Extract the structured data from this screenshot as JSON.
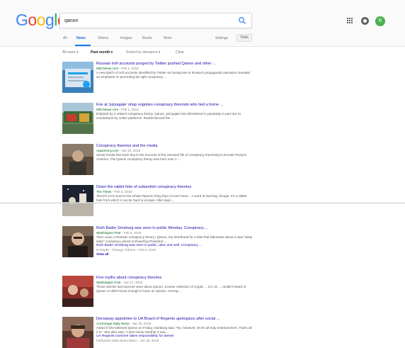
{
  "header": {
    "logo": [
      "G",
      "o",
      "o",
      "g",
      "l",
      "e"
    ],
    "logo_colors": [
      "#4285f4",
      "#ea4335",
      "#fbbc05",
      "#4285f4",
      "#34a853",
      "#ea4335"
    ],
    "search_value": "qanon",
    "avatar_letter": "R",
    "avatar_color": "#4caf50"
  },
  "tabs": {
    "items": [
      "All",
      "News",
      "Videos",
      "Images",
      "Books",
      "More"
    ],
    "active": "News",
    "settings_label": "Settings",
    "tools_label": "Tools"
  },
  "filters": {
    "news_type": "All news ▾",
    "time": "Past month ▾",
    "sort": "Sorted by relevance ▾",
    "clear": "Clear"
  },
  "results": [
    {
      "title": "Russian troll accounts purged by Twitter pushed Qanon and other ...",
      "source": "NBCNews.com",
      "date": "Feb 2, 2018",
      "snippet": "A new batch of troll accounts identified by Twitter as having ties to Russia's propaganda operation revealed an emphasis on promoting far-right conspiracy ..."
    },
    {
      "title": "Fire at 'pizzagate' shop reignites conspiracy theorists who lied a home ...",
      "source": "NBCNews.com",
      "date": "Feb 1, 2018",
      "snippet": "Eclipsed by a related conspiracy theory, Qanon, pizzagate has diminished in popularity in part due to crackdowns by online platforms. Reddit banned the ..."
    },
    {
      "title": "Conspiracy theories and the media",
      "source": "Apparency.com",
      "date": "Jan 18, 2018",
      "snippet": "Social media has been key to the success of the renewed life of conspiracy theorising in Donald Trump's America. The Qanon conspiracy theory was born over 4 ..."
    },
    {
      "title": "Down the rabbit hole of outlandish conspiracy theories",
      "source": "The Times",
      "date": "Feb 3, 2018",
      "snippet": "There's a lot more to the whole #Qanon thing than I'd ever have... A word of warning, though. It's a rabbit hole from which it can be hard to escape. After days ..."
    },
    {
      "title": "Ruth Bader Ginsburg was seen in public Monday. Conspiracy ...",
      "source": "Washington Post",
      "date": "Feb 6, 2018",
      "snippet": "Then came a Russian conspiracy theory | Qanon, the shorthand for a fake that fabricates about a vast \"deep state\" conspiracy aimed at thwarting President ...",
      "sub_title": "Ruth Bader Ginsburg was seen in public, alive and well. Conspiracy ...",
      "sub_source": "In-Depth - Chicago Tribune - Feb 6, 2018",
      "view_all": "View all"
    },
    {
      "title": "Five myths about conspiracy theories",
      "source": "Washington Post",
      "date": "Jan 17, 2018",
      "snippet": "Those articles last summer were about Qanon, a loose collection of cryptic ... it is 10 ... couldn't heard of Qanon or didn't know enough to have an opinion. Among ..."
    },
    {
      "title": "Dersaway appointee to UA Board of Regents apologizes after social ...",
      "source": "Anchorage Daily News",
      "date": "Jan 26, 2018",
      "snippet": "Asked if she believed Qanon on Friday, Hamburg said, \"No, however, let it's all truly entertainment. That's all it is.\" She also said, \"I don't know whether it was ...",
      "sub_title": "UA Regents nominee takes responsibility for tweets",
      "sub_source": "Fairbanks Daily News-Miner - Jan 26, 2018"
    }
  ]
}
